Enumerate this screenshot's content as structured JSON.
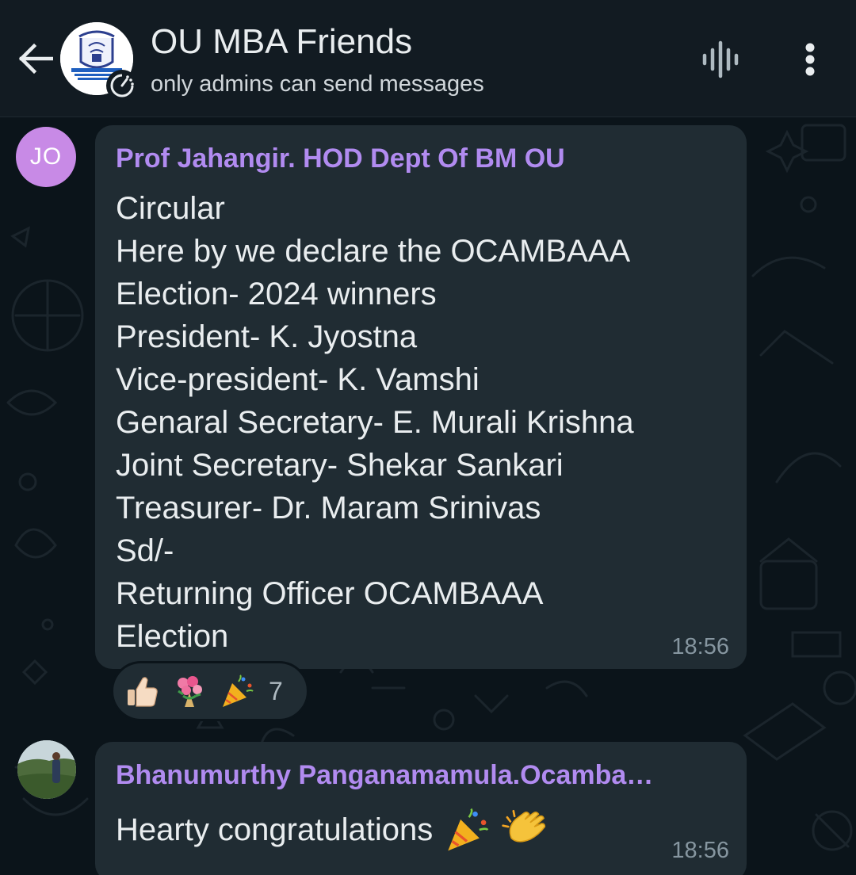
{
  "header": {
    "title": "OU MBA Friends",
    "subtitle": "only admins can send messages",
    "back_icon": "arrow-back-icon",
    "voice_icon": "voice-chat-icon",
    "menu_icon": "more-vert-icon"
  },
  "messages": [
    {
      "avatar_initials": "JO",
      "avatar_color": "#c88ae6",
      "sender": "Prof Jahangir. HOD Dept Of BM OU",
      "sender_color": "#b18bf0",
      "lines": [
        "Circular",
        "Here by we declare the OCAMBAAA",
        "Election- 2024 winners",
        "President- K. Jyostna",
        "Vice-president- K. Vamshi",
        "Genaral Secretary- E. Murali Krishna",
        "Joint Secretary- Shekar Sankari",
        "Treasurer- Dr. Maram Srinivas",
        "Sd/-",
        "Returning Officer OCAMBAAA",
        "Election"
      ],
      "time": "18:56",
      "reactions": {
        "emojis": [
          "thumbs-up-icon",
          "bouquet-icon",
          "party-popper-icon"
        ],
        "count": "7"
      }
    },
    {
      "sender": "Bhanumurthy Panganamamula.Ocamba…",
      "sender_color": "#b18bf0",
      "text": "Hearty congratulations",
      "emojis": [
        "party-popper-icon",
        "clapping-hands-icon"
      ],
      "time": "18:56"
    }
  ],
  "colors": {
    "header_bg": "#121b22",
    "chat_bg": "#0b141a",
    "bubble_bg": "#202c33",
    "text_primary": "#e9edef",
    "text_secondary": "#8696a0"
  }
}
